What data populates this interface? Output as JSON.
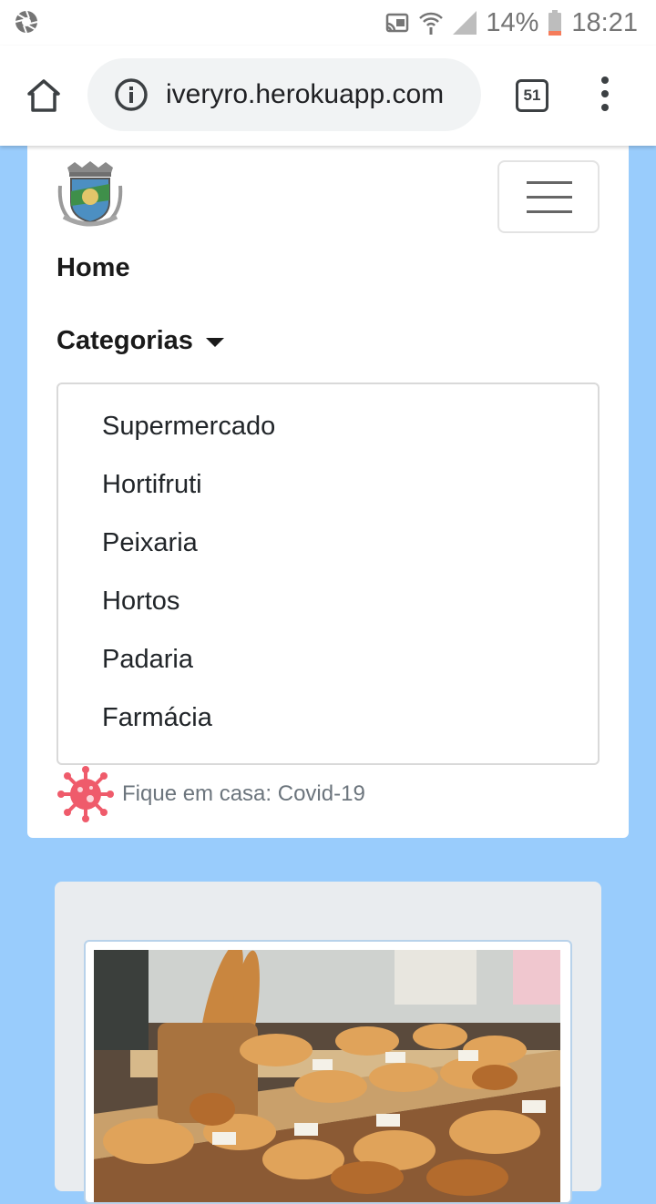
{
  "status_bar": {
    "battery": "14%",
    "time": "18:21"
  },
  "browser": {
    "url": "iveryro.herokuapp.com",
    "tab_count": "51"
  },
  "navbar": {
    "home_label": "Home",
    "categories_label": "Categorias",
    "categories": [
      "Supermercado",
      "Hortifruti",
      "Peixaria",
      "Hortos",
      "Padaria",
      "Farmácia"
    ],
    "covid_text": "Fique em casa: Covid-19"
  },
  "colors": {
    "page_background": "#99ccfc",
    "card_background": "#ffffff",
    "content_card_background": "#e9ecef",
    "covid_icon": "#ef5b6b"
  },
  "icons": {
    "status_left": "aperture-icon",
    "cast": "cast-icon",
    "wifi": "wifi-icon",
    "signal": "signal-icon",
    "battery": "battery-icon",
    "home": "home-icon",
    "info": "info-icon",
    "tabs": "tabs-icon",
    "menu": "more-vert-icon",
    "toggler": "hamburger-icon",
    "caret": "caret-down-icon",
    "covid": "virus-icon"
  }
}
